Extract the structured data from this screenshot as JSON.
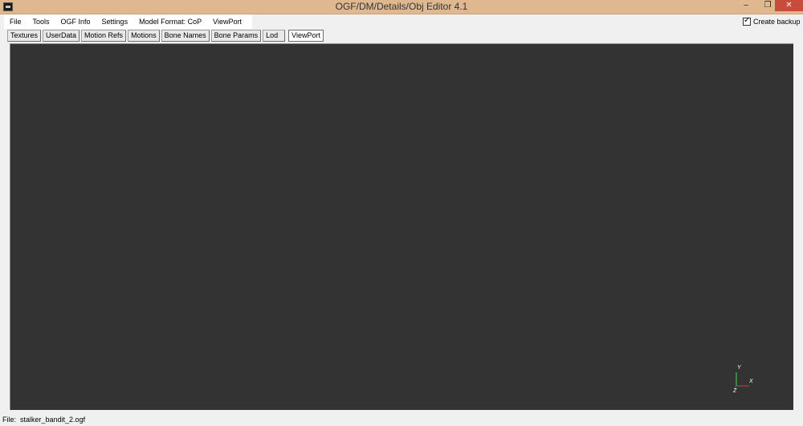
{
  "window": {
    "title": "OGF/DM/Details/Obj Editor 4.1",
    "min_glyph": "–",
    "max_glyph": "❐",
    "close_glyph": "✕"
  },
  "menu": {
    "items": [
      "File",
      "Tools",
      "OGF Info",
      "Settings",
      "Model Format: CoP",
      "ViewPort"
    ]
  },
  "backup": {
    "label": "Create backup",
    "checked": true
  },
  "tabs": {
    "items": [
      "Textures",
      "UserData",
      "Motion Refs",
      "Motions",
      "Bone Names",
      "Bone Params",
      "Lod",
      "ViewPort"
    ],
    "active": "ViewPort"
  },
  "viewport": {
    "background": "#333333",
    "axes": {
      "y_label": "Y",
      "x_label": "X",
      "z_label": "Z",
      "x_color": "#c0392b",
      "y_color": "#2ecc40",
      "z_color": "#2f5bd8"
    }
  },
  "status": {
    "label": "File:",
    "value": "stalker_bandit_2.ogf"
  }
}
